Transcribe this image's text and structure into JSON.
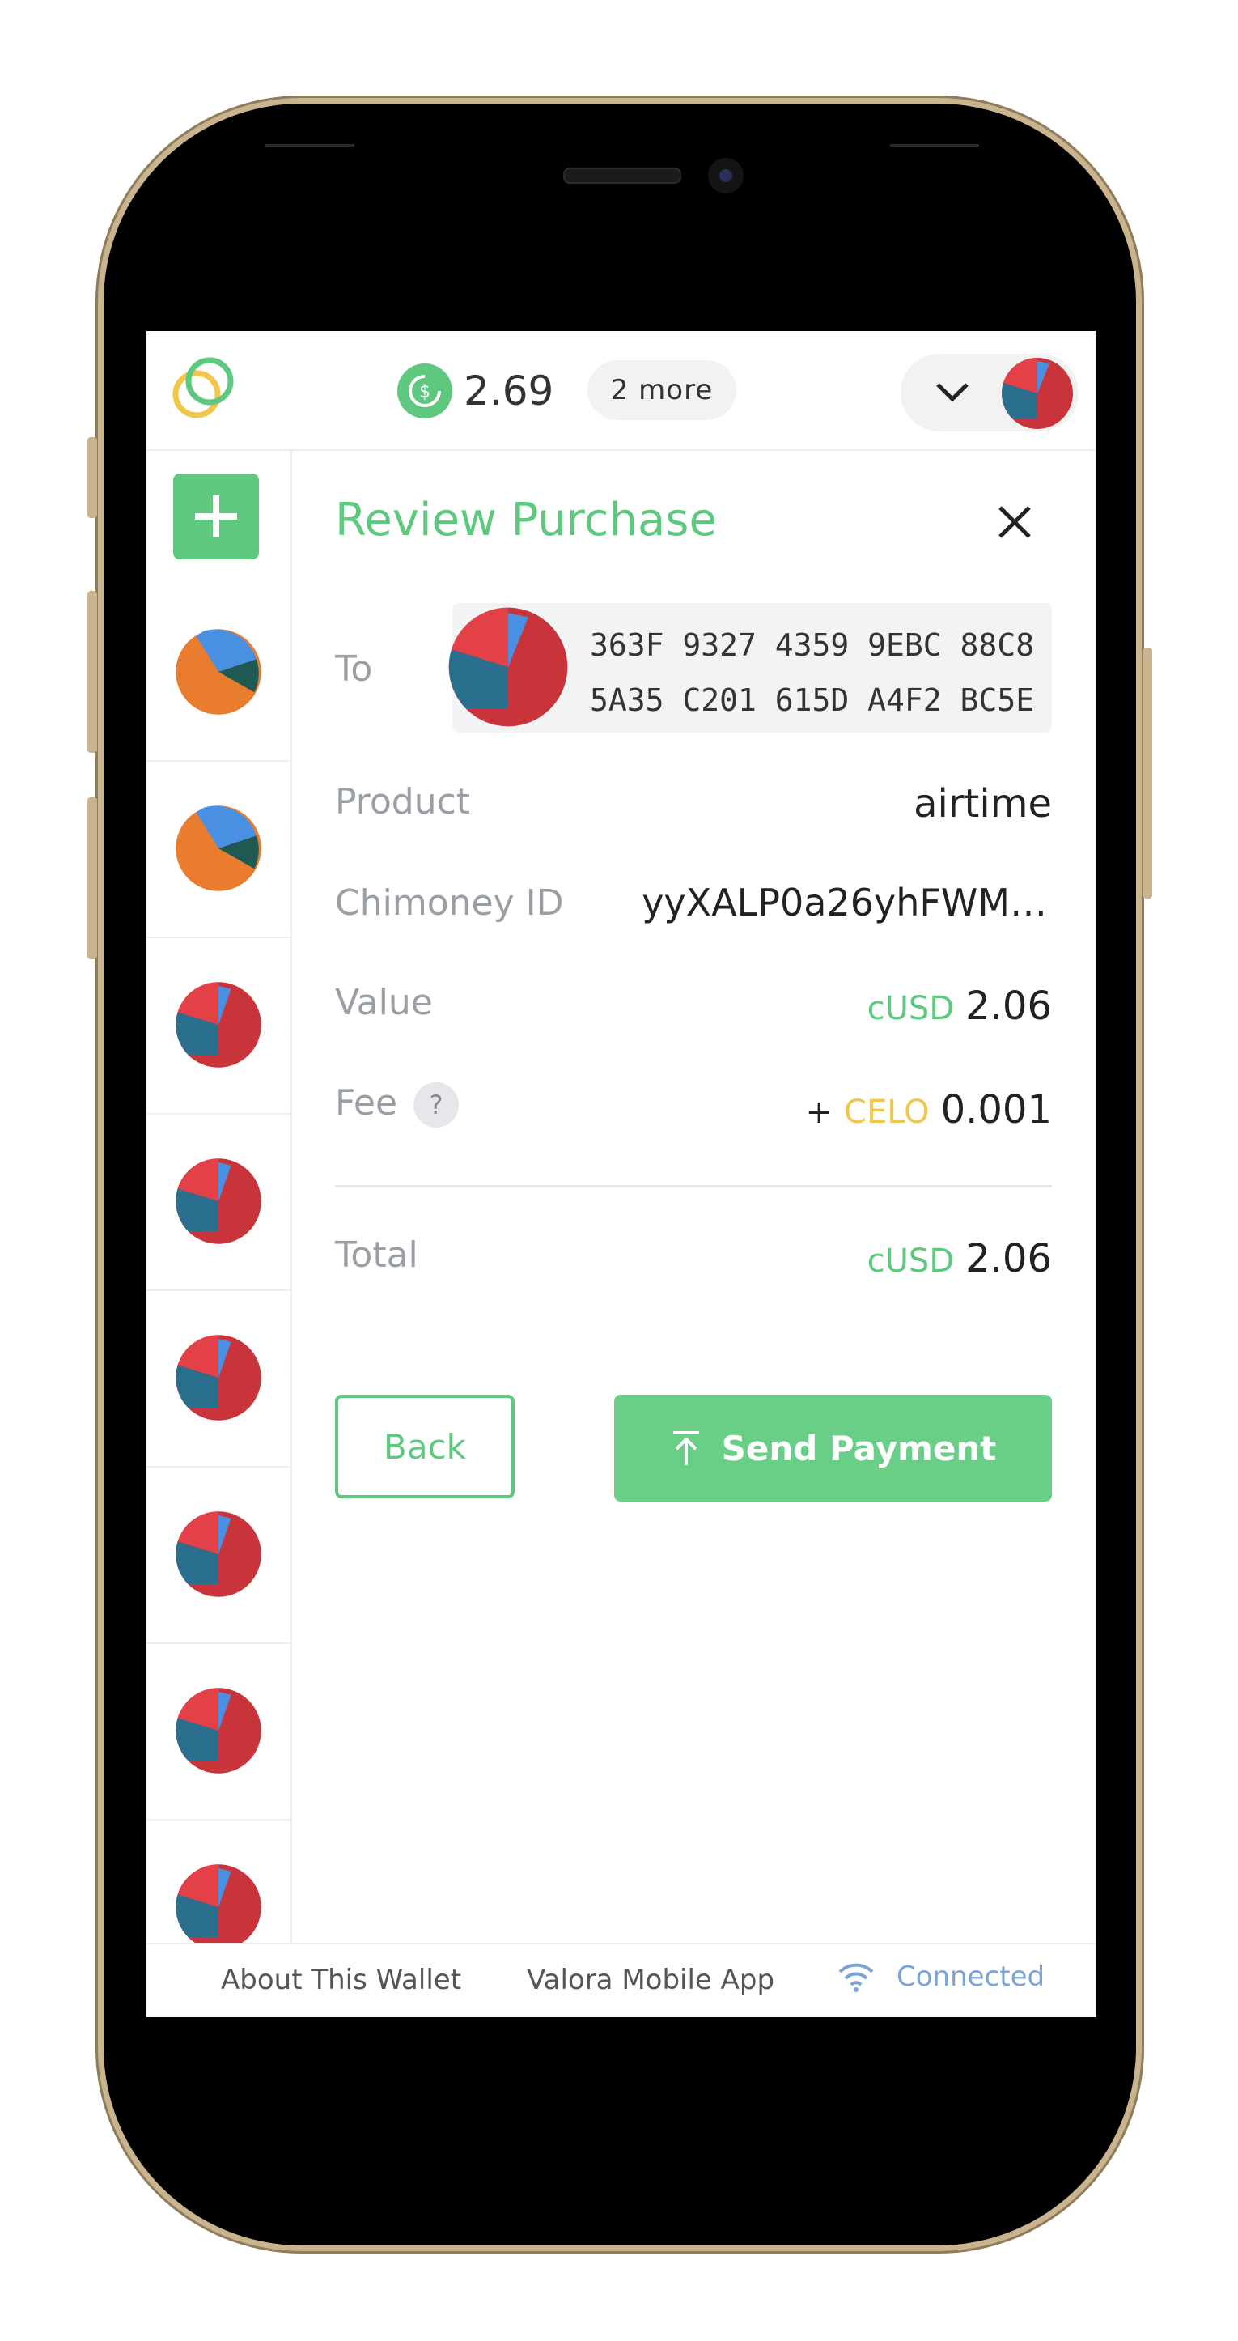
{
  "header": {
    "balance": "2.69",
    "more_tokens": "2 more"
  },
  "sidebar": {
    "add_label": "+",
    "accounts": [
      {
        "colors": [
          "#e97c2e",
          "#4a90e2",
          "#1f5a52"
        ]
      },
      {
        "colors": [
          "#e97c2e",
          "#4a90e2",
          "#1f5a52"
        ]
      },
      {
        "colors": [
          "#c8343a",
          "#2a6f8e",
          "#e44048"
        ]
      },
      {
        "colors": [
          "#c8343a",
          "#2a6f8e",
          "#e44048"
        ]
      },
      {
        "colors": [
          "#c8343a",
          "#2a6f8e",
          "#e44048"
        ]
      },
      {
        "colors": [
          "#c8343a",
          "#2a6f8e",
          "#e44048"
        ]
      },
      {
        "colors": [
          "#c8343a",
          "#2a6f8e",
          "#e44048"
        ]
      },
      {
        "colors": [
          "#c8343a",
          "#2a6f8e",
          "#e44048"
        ]
      }
    ]
  },
  "review": {
    "title": "Review Purchase",
    "to_label": "To",
    "address_line1": "363F 9327 4359 9EBC 88C8",
    "address_line2": "5A35 C201 615D A4F2 BC5E",
    "product_label": "Product",
    "product_value": "airtime",
    "chimoney_label": "Chimoney ID",
    "chimoney_value": "yyXALP0a26yhFWM…",
    "value_label": "Value",
    "value_currency": "cUSD",
    "value_amount": "2.06",
    "fee_label": "Fee",
    "fee_help": "?",
    "fee_plus": "+",
    "fee_currency": "CELO",
    "fee_amount": "0.001",
    "total_label": "Total",
    "total_currency": "cUSD",
    "total_amount": "2.06",
    "back_label": "Back",
    "send_label": "Send Payment"
  },
  "footer": {
    "about": "About This Wallet",
    "app": "Valora Mobile App",
    "status": "Connected"
  },
  "colors": {
    "accent": "#5ec97e",
    "celo": "#f0c74a",
    "connected": "#7aa4d6"
  }
}
